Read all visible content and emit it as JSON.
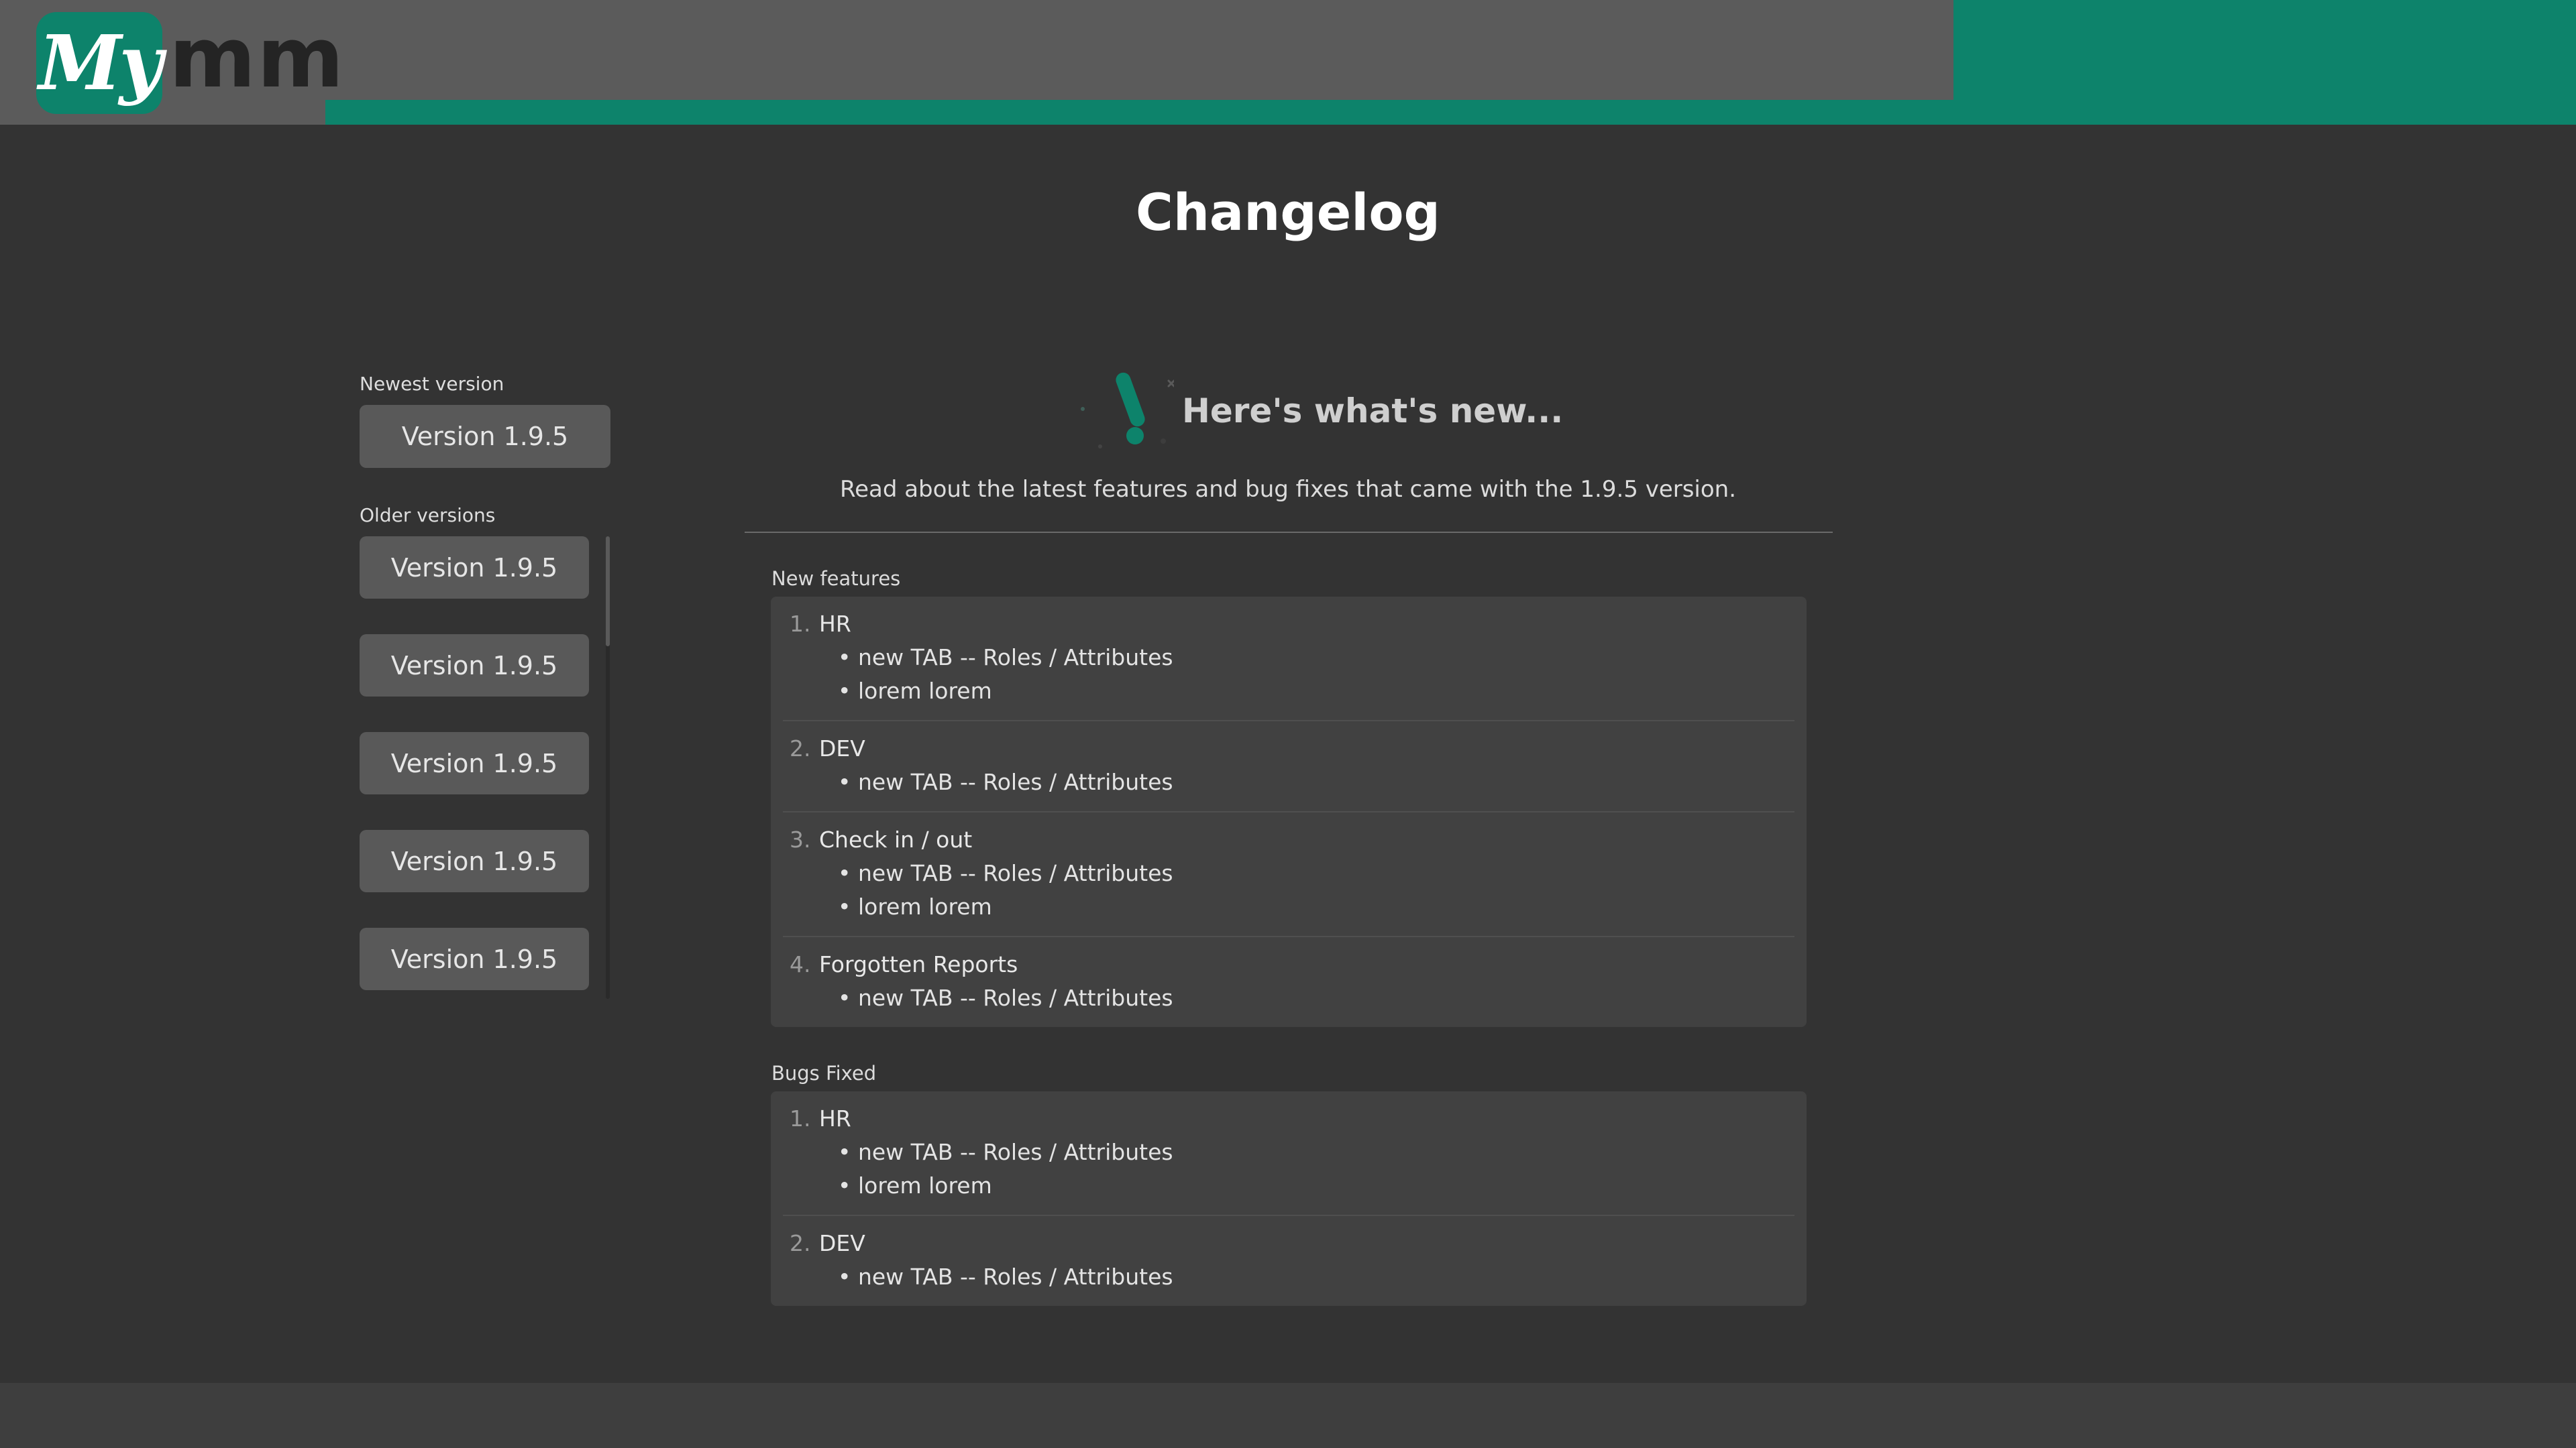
{
  "header": {
    "logo_badge": "My",
    "logo_text": "mm",
    "colors": {
      "brand_green": "#0d836b",
      "header_gray": "#5b5b5b"
    }
  },
  "page": {
    "title": "Changelog"
  },
  "sidebar": {
    "newest_label": "Newest version",
    "newest_version": "Version 1.9.5",
    "older_label": "Older versions",
    "older_versions": [
      "Version 1.9.5",
      "Version 1.9.5",
      "Version 1.9.5",
      "Version 1.9.5",
      "Version 1.9.5"
    ]
  },
  "main": {
    "heading": "Here's what's new...",
    "icon": "exclamation-icon",
    "subtitle": "Read about the latest features and bug fixes that came with the 1.9.5 version.",
    "sections": [
      {
        "label": "New features",
        "entries": [
          {
            "num": "1.",
            "title": "HR",
            "bullets": [
              "new TAB -- Roles / Attributes",
              "lorem lorem"
            ]
          },
          {
            "num": "2.",
            "title": "DEV",
            "bullets": [
              "new TAB -- Roles / Attributes"
            ]
          },
          {
            "num": "3.",
            "title": "Check in / out",
            "bullets": [
              "new TAB -- Roles / Attributes",
              "lorem lorem"
            ]
          },
          {
            "num": "4.",
            "title": "Forgotten Reports",
            "bullets": [
              "new TAB -- Roles / Attributes"
            ]
          }
        ]
      },
      {
        "label": "Bugs Fixed",
        "entries": [
          {
            "num": "1.",
            "title": "HR",
            "bullets": [
              "new TAB -- Roles / Attributes",
              "lorem lorem"
            ]
          },
          {
            "num": "2.",
            "title": "DEV",
            "bullets": [
              "new TAB -- Roles / Attributes"
            ]
          }
        ]
      }
    ]
  }
}
